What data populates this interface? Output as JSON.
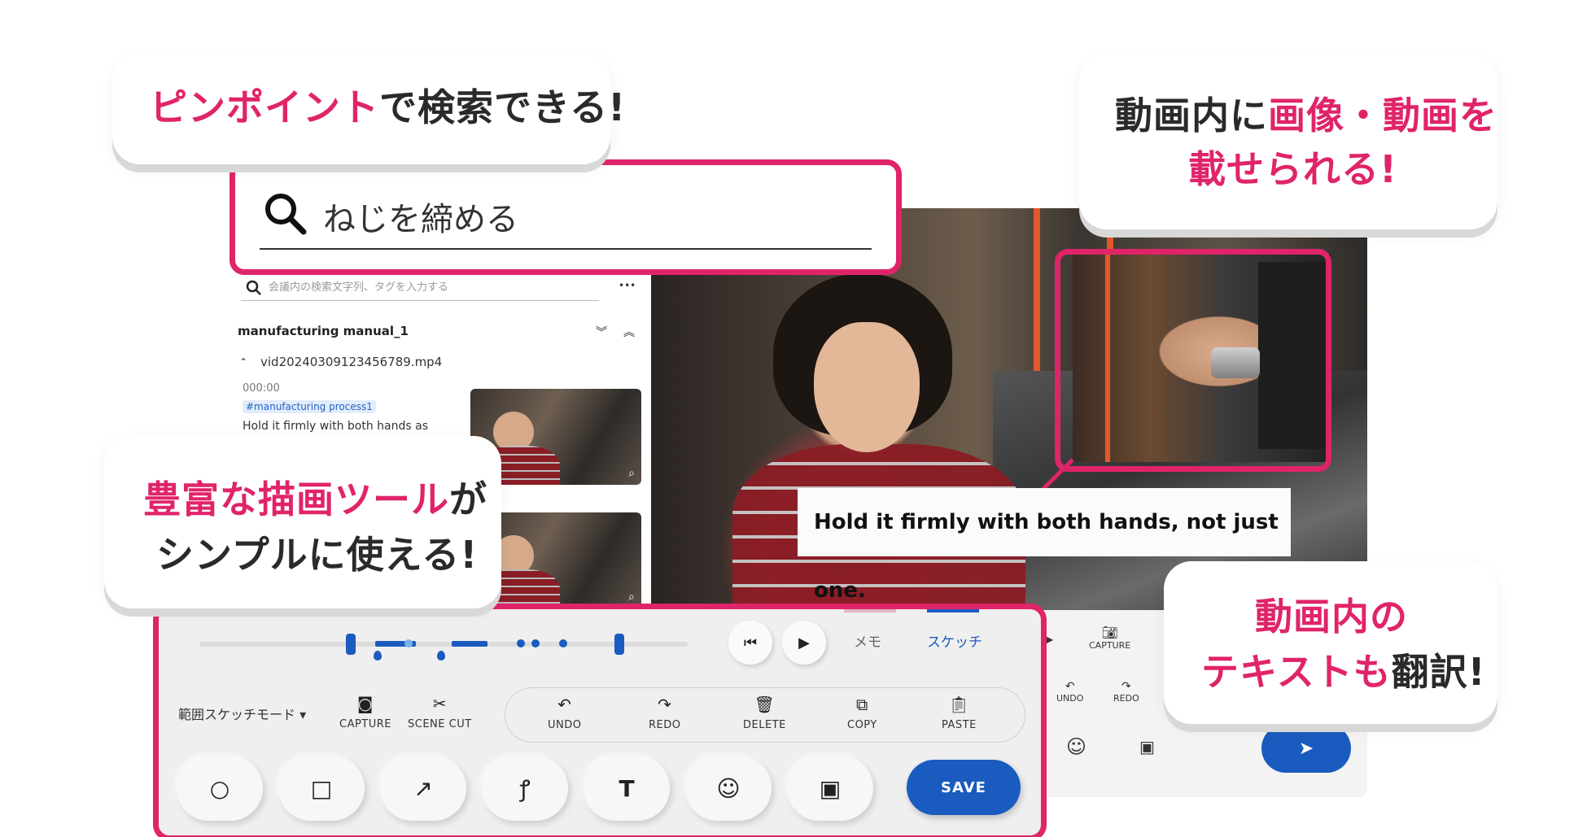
{
  "callouts": {
    "search": {
      "highlight": "ピンポイント",
      "rest": "で検索できる!"
    },
    "overlay": {
      "line1_dark": "動画内に",
      "line1_pink": "画像・動画を",
      "line2_pink": "載せられる!"
    },
    "drawing": {
      "line1_pink": "豊富な描画ツール",
      "line1_dark": "が",
      "line2_dark": "シンプルに使える!"
    },
    "translate": {
      "line1_pink": "動画内の",
      "line2_pink": "テキストも",
      "line2_dark": "翻訳!"
    }
  },
  "search_panel": {
    "query": "ねじを締める"
  },
  "side_list": {
    "search_placeholder": "会議内の検索文字列、タグを入力する",
    "more": "•••",
    "manual_title": "manufacturing manual_1",
    "file_name": "vid20240309123456789.mp4",
    "timecode": "000:00",
    "tag": "#manufacturing process1",
    "snippet": "Hold it firmly with both hands as"
  },
  "video": {
    "subtitle": "Hold it firmly with both hands, not just one."
  },
  "right_back": {
    "capture": "CAPTURE",
    "undo": "UNDO",
    "redo": "REDO"
  },
  "toolbar": {
    "tab_memo": "メモ",
    "tab_sketch": "スケッチ",
    "mode": "範囲スケッチモード ▾",
    "capture": "CAPTURE",
    "scene_cut": "SCENE CUT",
    "undo": "UNDO",
    "redo": "REDO",
    "delete": "DELETE",
    "copy": "COPY",
    "paste": "PASTE",
    "save": "SAVE"
  },
  "colors": {
    "accent_pink": "#e0246a",
    "primary_blue": "#1a5bbf"
  },
  "icons": [
    "search-icon",
    "chevron-double-down-icon",
    "chevron-double-up-icon",
    "chevron-up-icon",
    "zoom-icon",
    "skip-back-icon",
    "play-icon",
    "camera-icon",
    "scissors-icon",
    "undo-icon",
    "redo-icon",
    "trash-icon",
    "copy-icon",
    "clipboard-icon",
    "circle-icon",
    "square-icon",
    "arrow-icon",
    "freehand-icon",
    "text-icon",
    "emoji-icon",
    "image-icon",
    "send-icon"
  ]
}
